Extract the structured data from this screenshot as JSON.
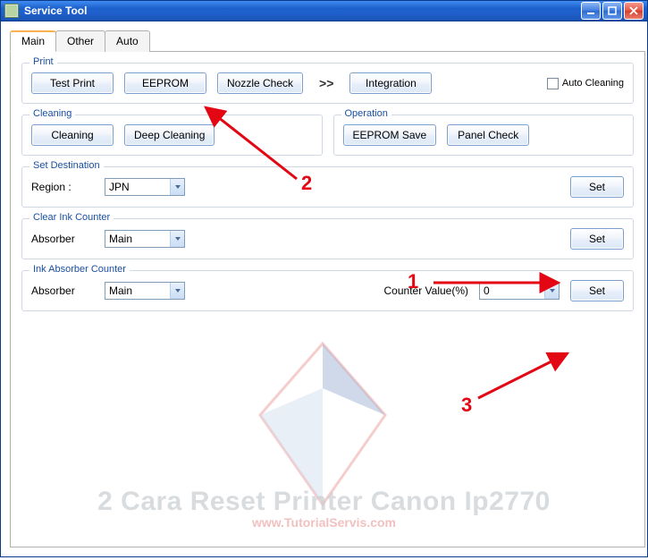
{
  "window": {
    "title": "Service Tool"
  },
  "tabs": {
    "main": "Main",
    "other": "Other",
    "auto": "Auto"
  },
  "groups": {
    "print": "Print",
    "cleaning": "Cleaning",
    "operation": "Operation",
    "dest": "Set Destination",
    "clear_ink": "Clear Ink Counter",
    "ink_abs": "Ink Absorber Counter"
  },
  "buttons": {
    "test_print": "Test Print",
    "eeprom": "EEPROM",
    "nozzle": "Nozzle Check",
    "integration": "Integration",
    "cleaning": "Cleaning",
    "deep_cleaning": "Deep Cleaning",
    "eeprom_save": "EEPROM Save",
    "panel_check": "Panel Check",
    "set": "Set"
  },
  "labels": {
    "auto_cleaning": "Auto Cleaning",
    "region": "Region :",
    "absorber": "Absorber",
    "counter_value": "Counter Value(%)"
  },
  "arrow": ">>",
  "values": {
    "region": "JPN",
    "clear_absorber": "Main",
    "ink_absorber": "Main",
    "counter_value": "0"
  },
  "annotations": {
    "n1": "1",
    "n2": "2",
    "n3": "3"
  },
  "watermark": {
    "title": "2 Cara Reset Printer Canon Ip2770",
    "url": "www.TutorialServis.com"
  }
}
